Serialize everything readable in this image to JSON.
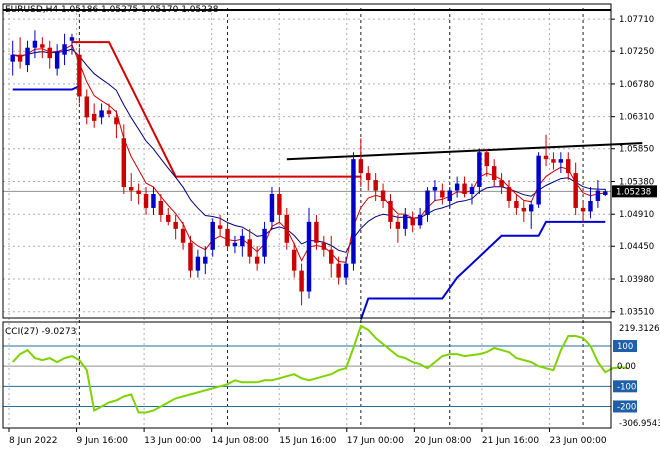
{
  "chart_data": {
    "type": "candlestick",
    "symbol_line": "EURUSD,H4  1.05186 1.05275 1.05170 1.05238",
    "price_ticks": [
      "1.07710",
      "1.07250",
      "1.06780",
      "1.06310",
      "1.05850",
      "1.05380",
      "1.04910",
      "1.04450",
      "1.03980",
      "1.03510"
    ],
    "price_ylim": [
      1.0342,
      1.0787
    ],
    "current_price": "1.05238",
    "time_labels": [
      "8 Jun 2022",
      "9 Jun 16:00",
      "13 Jun 00:00",
      "14 Jun 08:00",
      "15 Jun 16:00",
      "17 Jun 00:00",
      "20 Jun 08:00",
      "21 Jun 16:00",
      "23 Jun 00:00"
    ],
    "candles": [
      [
        1.071,
        1.074,
        1.069,
        1.072
      ],
      [
        1.072,
        1.0745,
        1.07,
        1.071
      ],
      [
        1.0705,
        1.074,
        1.0695,
        1.073
      ],
      [
        1.073,
        1.0755,
        1.0715,
        1.074
      ],
      [
        1.0735,
        1.0745,
        1.0715,
        1.073
      ],
      [
        1.073,
        1.074,
        1.07,
        1.0715
      ],
      [
        1.07,
        1.0735,
        1.069,
        1.0725
      ],
      [
        1.072,
        1.075,
        1.0705,
        1.0735
      ],
      [
        1.074,
        1.075,
        1.072,
        1.0745
      ],
      [
        1.072,
        1.073,
        1.065,
        1.066
      ],
      [
        1.066,
        1.067,
        1.062,
        1.063
      ],
      [
        1.0635,
        1.065,
        1.0615,
        1.0625
      ],
      [
        1.063,
        1.065,
        1.062,
        1.064
      ],
      [
        1.064,
        1.065,
        1.063,
        1.0635
      ],
      [
        1.063,
        1.064,
        1.06,
        1.062
      ],
      [
        1.06,
        1.062,
        1.052,
        1.053
      ],
      [
        1.053,
        1.055,
        1.051,
        1.0525
      ],
      [
        1.0525,
        1.0535,
        1.0505,
        1.052
      ],
      [
        1.052,
        1.053,
        1.049,
        1.05
      ],
      [
        1.05,
        1.053,
        1.049,
        1.052
      ],
      [
        1.051,
        1.052,
        1.048,
        1.049
      ],
      [
        1.049,
        1.05,
        1.0475,
        1.048
      ],
      [
        1.048,
        1.049,
        1.0455,
        1.047
      ],
      [
        1.047,
        1.048,
        1.044,
        1.045
      ],
      [
        1.045,
        1.046,
        1.04,
        1.041
      ],
      [
        1.041,
        1.044,
        1.04,
        1.043
      ],
      [
        1.042,
        1.0445,
        1.0405,
        1.043
      ],
      [
        1.044,
        1.0485,
        1.043,
        1.048
      ],
      [
        1.0475,
        1.049,
        1.046,
        1.047
      ],
      [
        1.047,
        1.048,
        1.044,
        1.0445
      ],
      [
        1.0445,
        1.046,
        1.0435,
        1.045
      ],
      [
        1.0445,
        1.047,
        1.043,
        1.046
      ],
      [
        1.0455,
        1.047,
        1.042,
        1.043
      ],
      [
        1.043,
        1.0445,
        1.041,
        1.042
      ],
      [
        1.043,
        1.048,
        1.042,
        1.047
      ],
      [
        1.048,
        1.053,
        1.047,
        1.052
      ],
      [
        1.052,
        1.053,
        1.048,
        1.049
      ],
      [
        1.049,
        1.05,
        1.044,
        1.045
      ],
      [
        1.044,
        1.045,
        1.04,
        1.041
      ],
      [
        1.041,
        1.042,
        1.036,
        1.038
      ],
      [
        1.038,
        1.05,
        1.037,
        1.048
      ],
      [
        1.048,
        1.049,
        1.044,
        1.045
      ],
      [
        1.045,
        1.046,
        1.043,
        1.044
      ],
      [
        1.044,
        1.046,
        1.04,
        1.042
      ],
      [
        1.042,
        1.043,
        1.039,
        1.04
      ],
      [
        1.04,
        1.043,
        1.039,
        1.042
      ],
      [
        1.042,
        1.058,
        1.041,
        1.057
      ],
      [
        1.057,
        1.06,
        1.053,
        1.055
      ],
      [
        1.055,
        1.056,
        1.0525,
        1.054
      ],
      [
        1.054,
        1.055,
        1.051,
        1.0525
      ],
      [
        1.0525,
        1.0535,
        1.05,
        1.051
      ],
      [
        1.051,
        1.052,
        1.047,
        1.048
      ],
      [
        1.048,
        1.049,
        1.045,
        1.047
      ],
      [
        1.047,
        1.05,
        1.046,
        1.049
      ],
      [
        1.0485,
        1.0495,
        1.0465,
        1.0475
      ],
      [
        1.0475,
        1.05,
        1.047,
        1.049
      ],
      [
        1.049,
        1.053,
        1.048,
        1.0525
      ],
      [
        1.0525,
        1.054,
        1.051,
        1.053
      ],
      [
        1.0525,
        1.0535,
        1.0505,
        1.0515
      ],
      [
        1.051,
        1.053,
        1.05,
        1.0525
      ],
      [
        1.0525,
        1.0545,
        1.0515,
        1.0535
      ],
      [
        1.0535,
        1.0545,
        1.0515,
        1.052
      ],
      [
        1.052,
        1.0535,
        1.0505,
        1.053
      ],
      [
        1.053,
        1.0585,
        1.052,
        1.058
      ],
      [
        1.058,
        1.0585,
        1.0545,
        1.056
      ],
      [
        1.056,
        1.057,
        1.053,
        1.054
      ],
      [
        1.054,
        1.055,
        1.052,
        1.053
      ],
      [
        1.053,
        1.054,
        1.05,
        1.051
      ],
      [
        1.051,
        1.052,
        1.049,
        1.05
      ],
      [
        1.05,
        1.051,
        1.048,
        1.0495
      ],
      [
        1.0495,
        1.051,
        1.047,
        1.0505
      ],
      [
        1.0505,
        1.058,
        1.05,
        1.0575
      ],
      [
        1.0575,
        1.0605,
        1.056,
        1.057
      ],
      [
        1.057,
        1.058,
        1.0555,
        1.0565
      ],
      [
        1.0565,
        1.058,
        1.055,
        1.057
      ],
      [
        1.057,
        1.058,
        1.054,
        1.055
      ],
      [
        1.055,
        1.0565,
        1.049,
        1.05
      ],
      [
        1.05,
        1.051,
        1.048,
        1.0495
      ],
      [
        1.0495,
        1.053,
        1.0485,
        1.051
      ],
      [
        1.051,
        1.054,
        1.05,
        1.0525
      ],
      [
        1.05186,
        1.05275,
        1.0517,
        1.05238
      ]
    ],
    "bands": {
      "red_upper": [
        [
          8,
          1.0738
        ],
        [
          13,
          1.0738
        ],
        [
          22,
          1.0545
        ],
        [
          47,
          1.0545
        ]
      ],
      "blue_lower": [
        [
          0,
          1.067
        ],
        [
          8,
          1.067
        ],
        [
          9,
          1.0675
        ]
      ],
      "blue_lower_2": [
        [
          47,
          1.034
        ],
        [
          48,
          1.037
        ],
        [
          58,
          1.037
        ],
        [
          60,
          1.04
        ],
        [
          62,
          1.042
        ],
        [
          66,
          1.046
        ],
        [
          71,
          1.046
        ],
        [
          72,
          1.048
        ],
        [
          80,
          1.048
        ]
      ]
    },
    "trendline": [
      [
        37,
        1.057
      ],
      [
        85,
        1.0593
      ]
    ],
    "ma_fast_color": "#d40000",
    "ma_slow_color": "#000080",
    "cci": {
      "label": "CCI(27) -9.0273",
      "ticks": [
        "100",
        "0.00",
        "-100",
        "-200"
      ],
      "levels": [
        100,
        0,
        -100,
        -200
      ],
      "max_label": "219.3126",
      "min_label": "-306.9543",
      "ylim": [
        -306.9543,
        219.3126
      ],
      "color": "#7fd400",
      "values": [
        20,
        60,
        80,
        40,
        30,
        40,
        20,
        40,
        50,
        30,
        -20,
        -220,
        -200,
        -180,
        -170,
        -150,
        -140,
        -230,
        -230,
        -220,
        -200,
        -180,
        -160,
        -150,
        -140,
        -130,
        -120,
        -110,
        -100,
        -90,
        -70,
        -80,
        -80,
        -80,
        -70,
        -70,
        -60,
        -50,
        -40,
        -60,
        -70,
        -60,
        -50,
        -40,
        -20,
        -10,
        90,
        200,
        180,
        140,
        110,
        80,
        50,
        40,
        20,
        10,
        -10,
        20,
        50,
        60,
        60,
        50,
        55,
        60,
        70,
        90,
        80,
        70,
        40,
        30,
        20,
        0,
        -10,
        -20,
        80,
        150,
        150,
        140,
        100,
        20,
        -30,
        -10,
        -5,
        -9
      ]
    }
  }
}
